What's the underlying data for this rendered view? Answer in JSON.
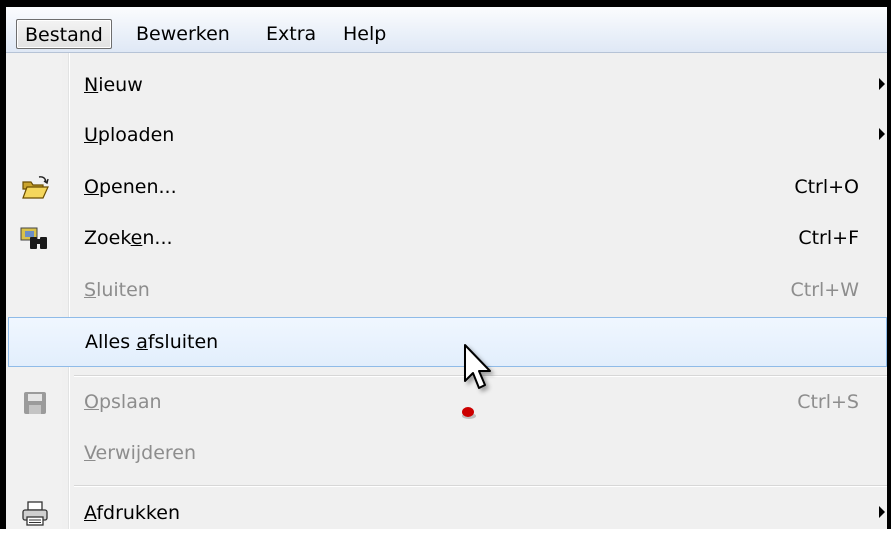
{
  "menubar": {
    "items": [
      {
        "label": "Bestand",
        "active": true
      },
      {
        "label": "Bewerken"
      },
      {
        "label": "Extra"
      },
      {
        "label": "Help"
      }
    ]
  },
  "menu": {
    "items": [
      {
        "accel": "N",
        "rest": "ieuw",
        "submenu": true
      },
      {
        "accel": "U",
        "rest": "ploaden",
        "submenu": true
      },
      {
        "accel": "O",
        "rest": "penen...",
        "shortcut": "Ctrl+O",
        "icon": "open-folder-icon"
      },
      {
        "pre": "Zoek",
        "accel": "e",
        "rest": "n...",
        "shortcut": "Ctrl+F",
        "icon": "binoculars-icon"
      },
      {
        "accel": "S",
        "rest": "luiten",
        "shortcut": "Ctrl+W",
        "disabled": true
      },
      {
        "pre": "Alles ",
        "accel": "a",
        "rest": "fsluiten",
        "hover": true
      },
      {
        "accel": "O",
        "rest": "pslaan",
        "shortcut": "Ctrl+S",
        "disabled": true,
        "icon": "floppy-disk-icon"
      },
      {
        "accel": "V",
        "rest": "erwijderen",
        "disabled": true
      },
      {
        "accel": "A",
        "rest": "fdrukken",
        "submenu": true,
        "icon": "printer-icon"
      }
    ]
  },
  "colors": {
    "hover_border": "#8fbbe8",
    "disabled_text": "#8d8d8d",
    "cursor_dot": "#cc0000"
  }
}
